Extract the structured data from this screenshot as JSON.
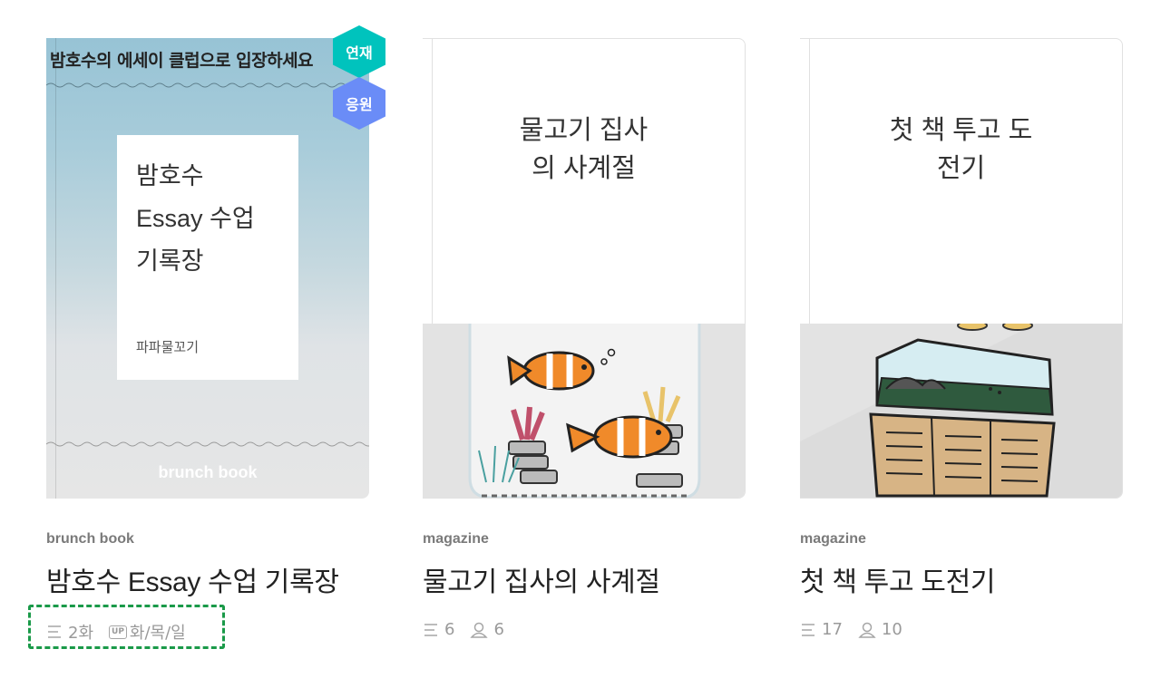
{
  "cards": [
    {
      "type_label": "brunch book",
      "title": "밤호수 Essay 수업 기록장",
      "cover": {
        "top_text": "밤호수의 에세이 클럽으로 입장하세요",
        "inner_title": "밤호수\nEssay 수업\n기록장",
        "author": "파파물꼬기",
        "label": "brunch book"
      },
      "badges": [
        "연재",
        "응원"
      ],
      "stats": {
        "episodes": "2화",
        "up_tag": "UP",
        "update_days": "화/목/일"
      }
    },
    {
      "type_label": "magazine",
      "title": "물고기 집사의 사계절",
      "cover": {
        "inner_title": "물고기 집사\n의 사계절"
      },
      "stats": {
        "episodes": "6",
        "subscribers": "6"
      }
    },
    {
      "type_label": "magazine",
      "title": "첫 책 투고 도전기",
      "cover": {
        "inner_title": "첫 책 투고 도\n전기"
      },
      "stats": {
        "episodes": "17",
        "subscribers": "10"
      }
    }
  ],
  "colors": {
    "badge_serial": "#00c3bd",
    "badge_cheer": "#6a8cf7",
    "highlight": "#1a9a49"
  }
}
